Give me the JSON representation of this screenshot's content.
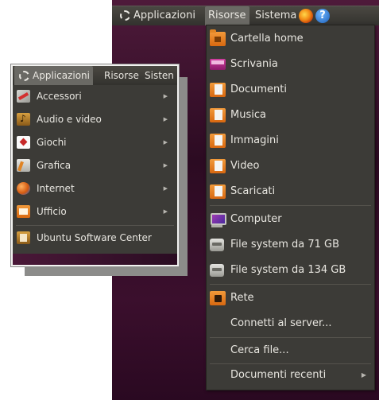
{
  "top_panel": {
    "applicazioni": "Applicazioni",
    "risorse": "Risorse",
    "sistema": "Sistema",
    "help_glyph": "?"
  },
  "risorse_menu": {
    "items": [
      {
        "label": "Cartella home",
        "icon": "home-folder-icon"
      },
      {
        "label": "Scrivania",
        "icon": "desktop-folder-icon"
      },
      {
        "label": "Documenti",
        "icon": "documents-folder-icon"
      },
      {
        "label": "Musica",
        "icon": "music-folder-icon"
      },
      {
        "label": "Immagini",
        "icon": "pictures-folder-icon"
      },
      {
        "label": "Video",
        "icon": "video-folder-icon"
      },
      {
        "label": "Scaricati",
        "icon": "downloads-folder-icon"
      },
      {
        "label": "Computer",
        "icon": "computer-icon"
      },
      {
        "label": "File system da 71 GB",
        "icon": "drive-icon"
      },
      {
        "label": "File system da 134 GB",
        "icon": "drive-icon"
      },
      {
        "label": "Rete",
        "icon": "network-icon"
      },
      {
        "label": "Connetti al server..."
      },
      {
        "label": "Cerca file..."
      },
      {
        "label": "Documenti recenti",
        "submenu": true
      }
    ]
  },
  "apps_panel": {
    "applicazioni": "Applicazioni",
    "risorse": "Risorse",
    "sistema": "Sisten"
  },
  "apps_menu": {
    "items": [
      {
        "label": "Accessori",
        "icon": "accessories-icon",
        "submenu": true
      },
      {
        "label": "Audio e video",
        "icon": "audio-video-icon",
        "submenu": true
      },
      {
        "label": "Giochi",
        "icon": "games-icon",
        "submenu": true
      },
      {
        "label": "Grafica",
        "icon": "graphics-icon",
        "submenu": true
      },
      {
        "label": "Internet",
        "icon": "internet-icon",
        "submenu": true
      },
      {
        "label": "Ufficio",
        "icon": "office-icon",
        "submenu": true
      },
      {
        "label": "Ubuntu Software Center",
        "icon": "software-center-icon"
      }
    ]
  },
  "colors": {
    "menu_bg": "#3c3b37",
    "panel_bg": "#33322e",
    "wallpaper": "#3b0f2d"
  }
}
